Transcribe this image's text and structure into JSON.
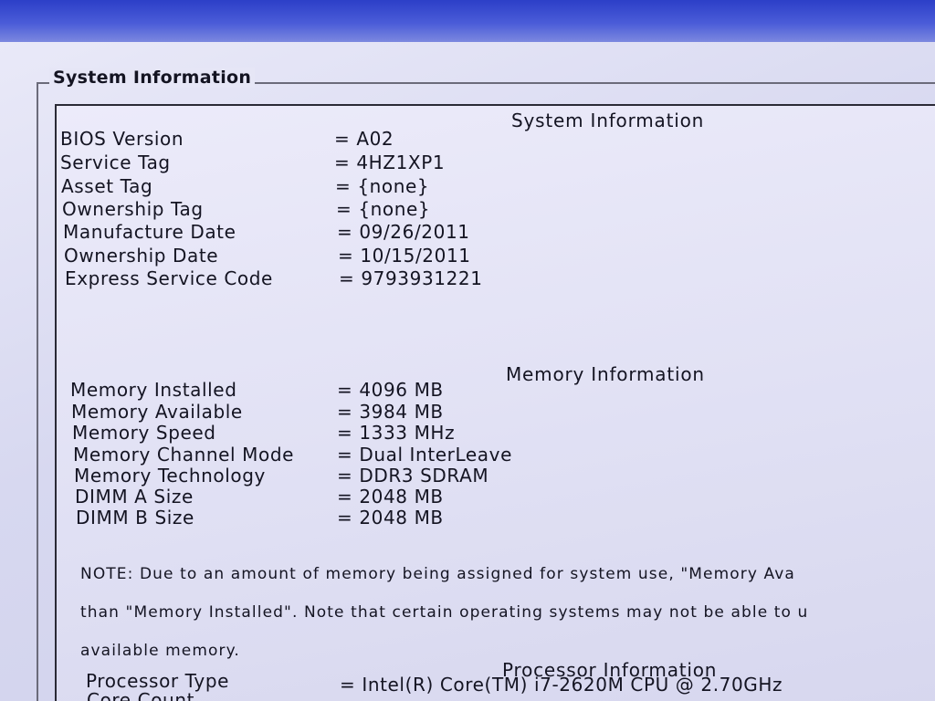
{
  "group": {
    "title": "System Information"
  },
  "system": {
    "heading": "System Information",
    "rows": [
      {
        "label": "BIOS Version",
        "value": "= A02"
      },
      {
        "label": "Service Tag",
        "value": "= 4HZ1XP1"
      },
      {
        "label": "Asset Tag",
        "value": "= {none}"
      },
      {
        "label": "Ownership Tag",
        "value": "= {none}"
      },
      {
        "label": "Manufacture Date",
        "value": "= 09/26/2011"
      },
      {
        "label": "Ownership Date",
        "value": "= 10/15/2011"
      },
      {
        "label": "Express Service Code",
        "value": "= 9793931221"
      }
    ]
  },
  "memory": {
    "heading": "Memory Information",
    "rows": [
      {
        "label": "Memory Installed",
        "value": "= 4096 MB"
      },
      {
        "label": "Memory Available",
        "value": "= 3984 MB"
      },
      {
        "label": "Memory Speed",
        "value": "= 1333 MHz"
      },
      {
        "label": "Memory Channel Mode",
        "value": "= Dual InterLeave"
      },
      {
        "label": "Memory Technology",
        "value": "= DDR3 SDRAM"
      },
      {
        "label": "DIMM A Size",
        "value": "= 2048 MB"
      },
      {
        "label": "DIMM B Size",
        "value": "= 2048 MB"
      }
    ],
    "note_lines": [
      "NOTE: Due to an amount of memory being assigned for system use, \"Memory Ava",
      "than \"Memory Installed\". Note that certain operating systems may not be able to u",
      "available memory."
    ]
  },
  "processor": {
    "heading": "Processor Information",
    "rows": [
      {
        "label": "Processor Type",
        "value": "= Intel(R) Core(TM) i7-2620M CPU @ 2.70GHz"
      },
      {
        "label": "Core Count",
        "value": ""
      }
    ]
  },
  "colors": {
    "title_bar": "#3a4cd0",
    "background": "#dcdcf2",
    "text": "#141422"
  }
}
